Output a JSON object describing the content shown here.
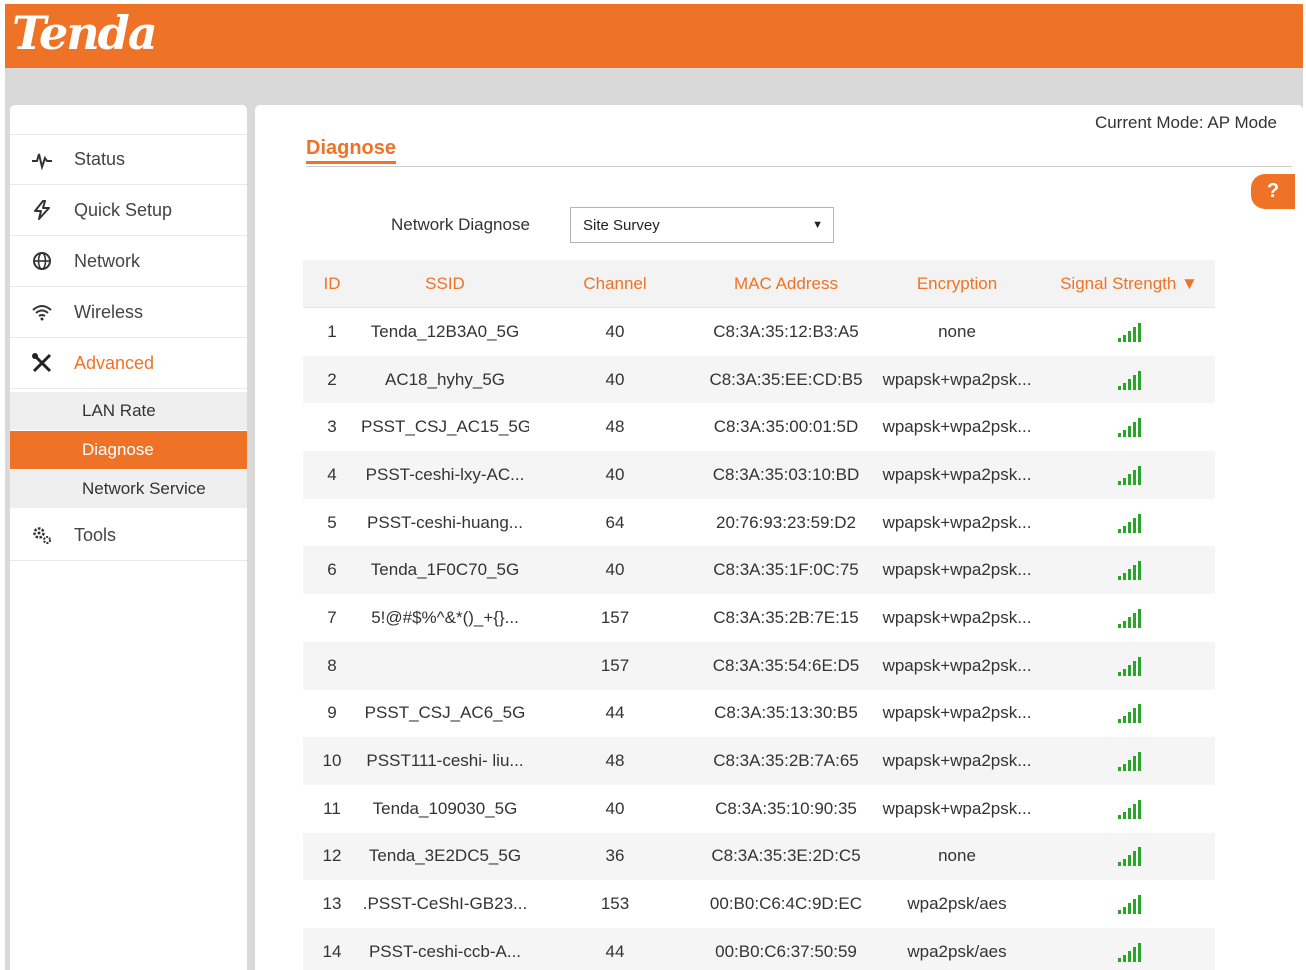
{
  "header": {
    "logo_text": "Tenda",
    "brand_color": "#ee7326"
  },
  "sidebar": {
    "items": [
      {
        "label": "Status",
        "icon": "pulse-icon"
      },
      {
        "label": "Quick Setup",
        "icon": "lightning-icon"
      },
      {
        "label": "Network",
        "icon": "globe-icon"
      },
      {
        "label": "Wireless",
        "icon": "wifi-icon"
      },
      {
        "label": "Advanced",
        "icon": "tools-cross-icon"
      },
      {
        "label": "Tools",
        "icon": "gears-icon"
      }
    ],
    "subitems": [
      {
        "label": "LAN Rate"
      },
      {
        "label": "Diagnose"
      },
      {
        "label": "Network Service"
      }
    ]
  },
  "main": {
    "mode": "Current Mode: AP Mode",
    "title": "Diagnose",
    "help": "?",
    "network_diagnose_label": "Network Diagnose",
    "network_diagnose_value": "Site Survey"
  },
  "table": {
    "headers": [
      "ID",
      "SSID",
      "Channel",
      "MAC Address",
      "Encryption",
      "Signal Strength ▼"
    ],
    "rows": [
      [
        "1",
        "Tenda_12B3A0_5G",
        "40",
        "C8:3A:35:12:B3:A5",
        "none"
      ],
      [
        "2",
        "AC18_hyhy_5G",
        "40",
        "C8:3A:35:EE:CD:B5",
        "wpapsk+wpa2psk..."
      ],
      [
        "3",
        "PSST_CSJ_AC15_5G",
        "48",
        "C8:3A:35:00:01:5D",
        "wpapsk+wpa2psk..."
      ],
      [
        "4",
        "PSST-ceshi-lxy-AC...",
        "40",
        "C8:3A:35:03:10:BD",
        "wpapsk+wpa2psk..."
      ],
      [
        "5",
        "PSST-ceshi-huang...",
        "64",
        "20:76:93:23:59:D2",
        "wpapsk+wpa2psk..."
      ],
      [
        "6",
        "Tenda_1F0C70_5G",
        "40",
        "C8:3A:35:1F:0C:75",
        "wpapsk+wpa2psk..."
      ],
      [
        "7",
        "5!@#$%^&*()_+{}...",
        "157",
        "C8:3A:35:2B:7E:15",
        "wpapsk+wpa2psk..."
      ],
      [
        "8",
        "",
        "157",
        "C8:3A:35:54:6E:D5",
        "wpapsk+wpa2psk..."
      ],
      [
        "9",
        "PSST_CSJ_AC6_5G",
        "44",
        "C8:3A:35:13:30:B5",
        "wpapsk+wpa2psk..."
      ],
      [
        "10",
        "PSST111-ceshi- liu...",
        "48",
        "C8:3A:35:2B:7A:65",
        "wpapsk+wpa2psk..."
      ],
      [
        "11",
        "Tenda_109030_5G",
        "40",
        "C8:3A:35:10:90:35",
        "wpapsk+wpa2psk..."
      ],
      [
        "12",
        "Tenda_3E2DC5_5G",
        "36",
        "C8:3A:35:3E:2D:C5",
        "none"
      ],
      [
        "13",
        ".PSST-CeShI-GB23...",
        "153",
        "00:B0:C6:4C:9D:EC",
        "wpa2psk/aes"
      ],
      [
        "14",
        "PSST-ceshi-ccb-A...",
        "44",
        "00:B0:C6:37:50:59",
        "wpa2psk/aes"
      ]
    ],
    "signal_icon": "signal-bars-icon",
    "signal_color": "#2aa52a"
  }
}
